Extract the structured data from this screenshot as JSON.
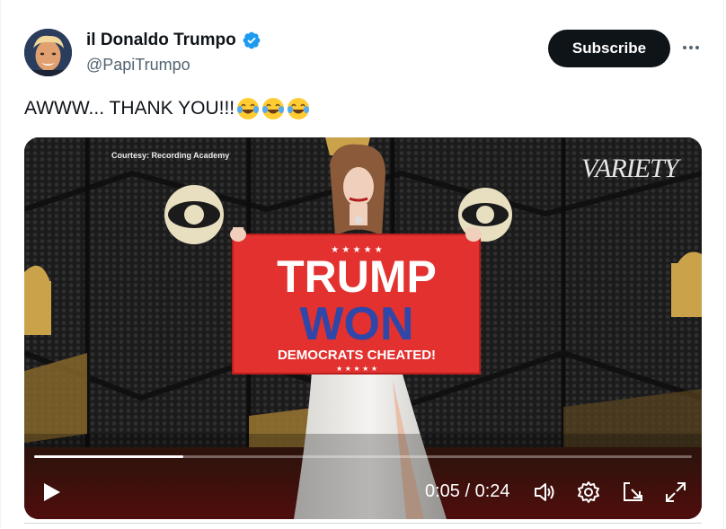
{
  "author": {
    "display_name": "il Donaldo Trumpo",
    "handle": "@PapiTrumpo",
    "verified": true
  },
  "actions": {
    "subscribe_label": "Subscribe",
    "more_icon": "more-horizontal-icon"
  },
  "tweet": {
    "text": "AWWW... THANK YOU!!!",
    "emojis": [
      "face-with-tears-of-joy",
      "face-with-tears-of-joy",
      "face-with-tears-of-joy"
    ]
  },
  "video": {
    "watermark": "Courtesy: Recording Academy",
    "brand": "VARIETY",
    "flag_line1": "TRUMP",
    "flag_line2": "WON",
    "flag_line3": "DEMOCRATS CHEATED!",
    "flag_stars": "★ ★ ★ ★ ★",
    "progress_fraction": 0.227,
    "time_display": "0:05 / 0:24",
    "controls": [
      "play-icon",
      "volume-icon",
      "settings-icon",
      "pop-out-icon",
      "fullscreen-icon"
    ]
  },
  "colors": {
    "accent": "#1d9bf0",
    "subscribe_bg": "#0f1419",
    "flag_red": "#e2312f",
    "flag_blue": "#2f47a8"
  }
}
